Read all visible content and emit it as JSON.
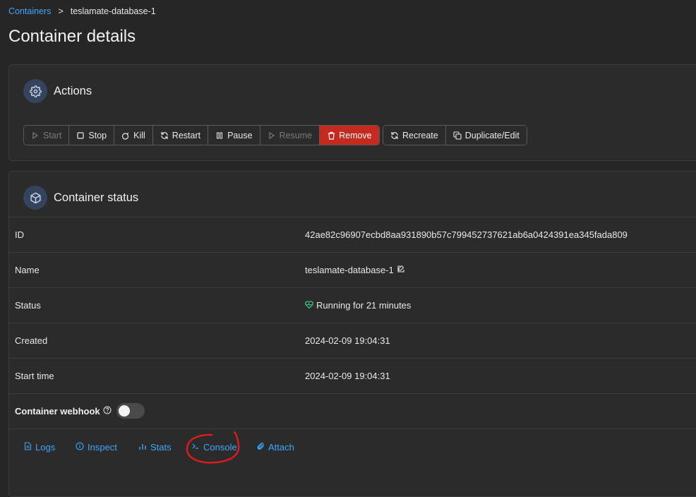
{
  "breadcrumb": {
    "parent": "Containers",
    "separator": ">",
    "current": "teslamate-database-1"
  },
  "page_title": "Container details",
  "actions": {
    "title": "Actions",
    "group1": [
      {
        "label": "Start",
        "disabled": true
      },
      {
        "label": "Stop",
        "disabled": false
      },
      {
        "label": "Kill",
        "disabled": false
      },
      {
        "label": "Restart",
        "disabled": false
      },
      {
        "label": "Pause",
        "disabled": false
      },
      {
        "label": "Resume",
        "disabled": true
      },
      {
        "label": "Remove",
        "danger": true
      }
    ],
    "group2": [
      {
        "label": "Recreate"
      },
      {
        "label": "Duplicate/Edit"
      }
    ]
  },
  "status": {
    "title": "Container status",
    "rows": [
      {
        "label": "ID",
        "value": "42ae82c96907ecbd8aa931890b57c799452737621ab6a0424391ea345fada809"
      },
      {
        "label": "Name",
        "value": "teslamate-database-1"
      },
      {
        "label": "Status",
        "value": "Running for 21 minutes"
      },
      {
        "label": "Created",
        "value": "2024-02-09 19:04:31"
      },
      {
        "label": "Start time",
        "value": "2024-02-09 19:04:31"
      }
    ],
    "webhook_label": "Container webhook",
    "webhook_enabled": false,
    "links": [
      {
        "label": "Logs",
        "icon": "file-icon"
      },
      {
        "label": "Inspect",
        "icon": "info-icon"
      },
      {
        "label": "Stats",
        "icon": "bar-chart-icon"
      },
      {
        "label": "Console",
        "icon": "terminal-icon"
      },
      {
        "label": "Attach",
        "icon": "paperclip-icon"
      }
    ]
  },
  "colors": {
    "accent": "#3ea6ff",
    "danger": "#c52a1e",
    "success": "#3ecf8e",
    "annotation": "#e01b1b"
  }
}
